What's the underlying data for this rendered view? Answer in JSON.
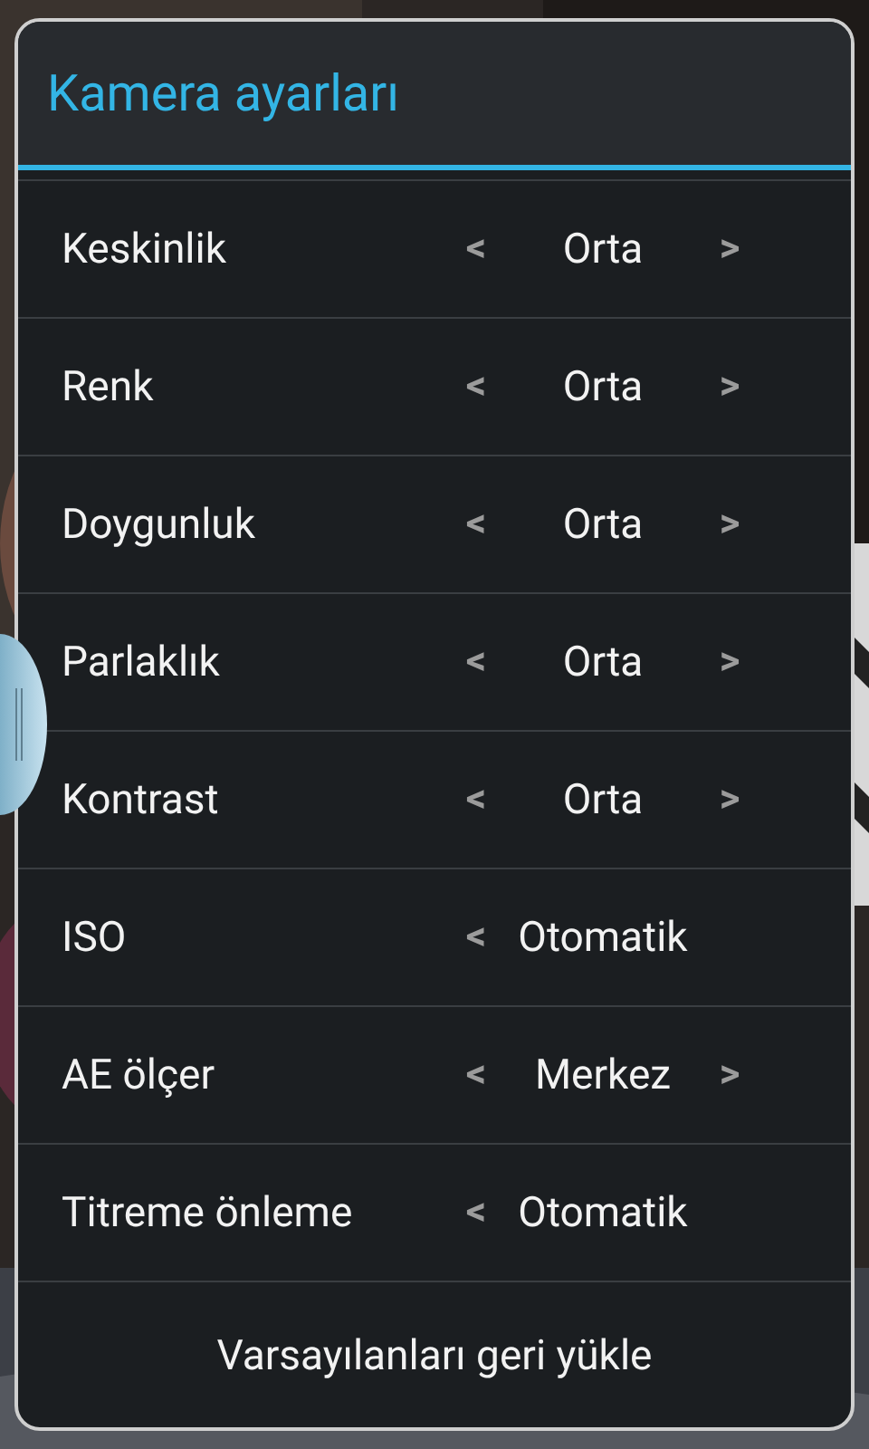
{
  "dialog": {
    "title": "Kamera ayarları",
    "settings": [
      {
        "label": "Keskinlik",
        "prev": "<",
        "value": "Orta",
        "next": ">"
      },
      {
        "label": "Renk",
        "prev": "<",
        "value": "Orta",
        "next": ">"
      },
      {
        "label": "Doygunluk",
        "prev": "<",
        "value": "Orta",
        "next": ">"
      },
      {
        "label": "Parlaklık",
        "prev": "<",
        "value": "Orta",
        "next": ">"
      },
      {
        "label": "Kontrast",
        "prev": "<",
        "value": "Orta",
        "next": ">"
      },
      {
        "label": "ISO",
        "prev": "<",
        "value": "Otomatik"
      },
      {
        "label": "AE ölçer",
        "prev": "<",
        "value": "Merkez",
        "next": ">"
      },
      {
        "label": "Titreme önleme",
        "prev": "<",
        "value": "Otomatik"
      }
    ],
    "reset_button": "Varsayılanları geri yükle"
  }
}
